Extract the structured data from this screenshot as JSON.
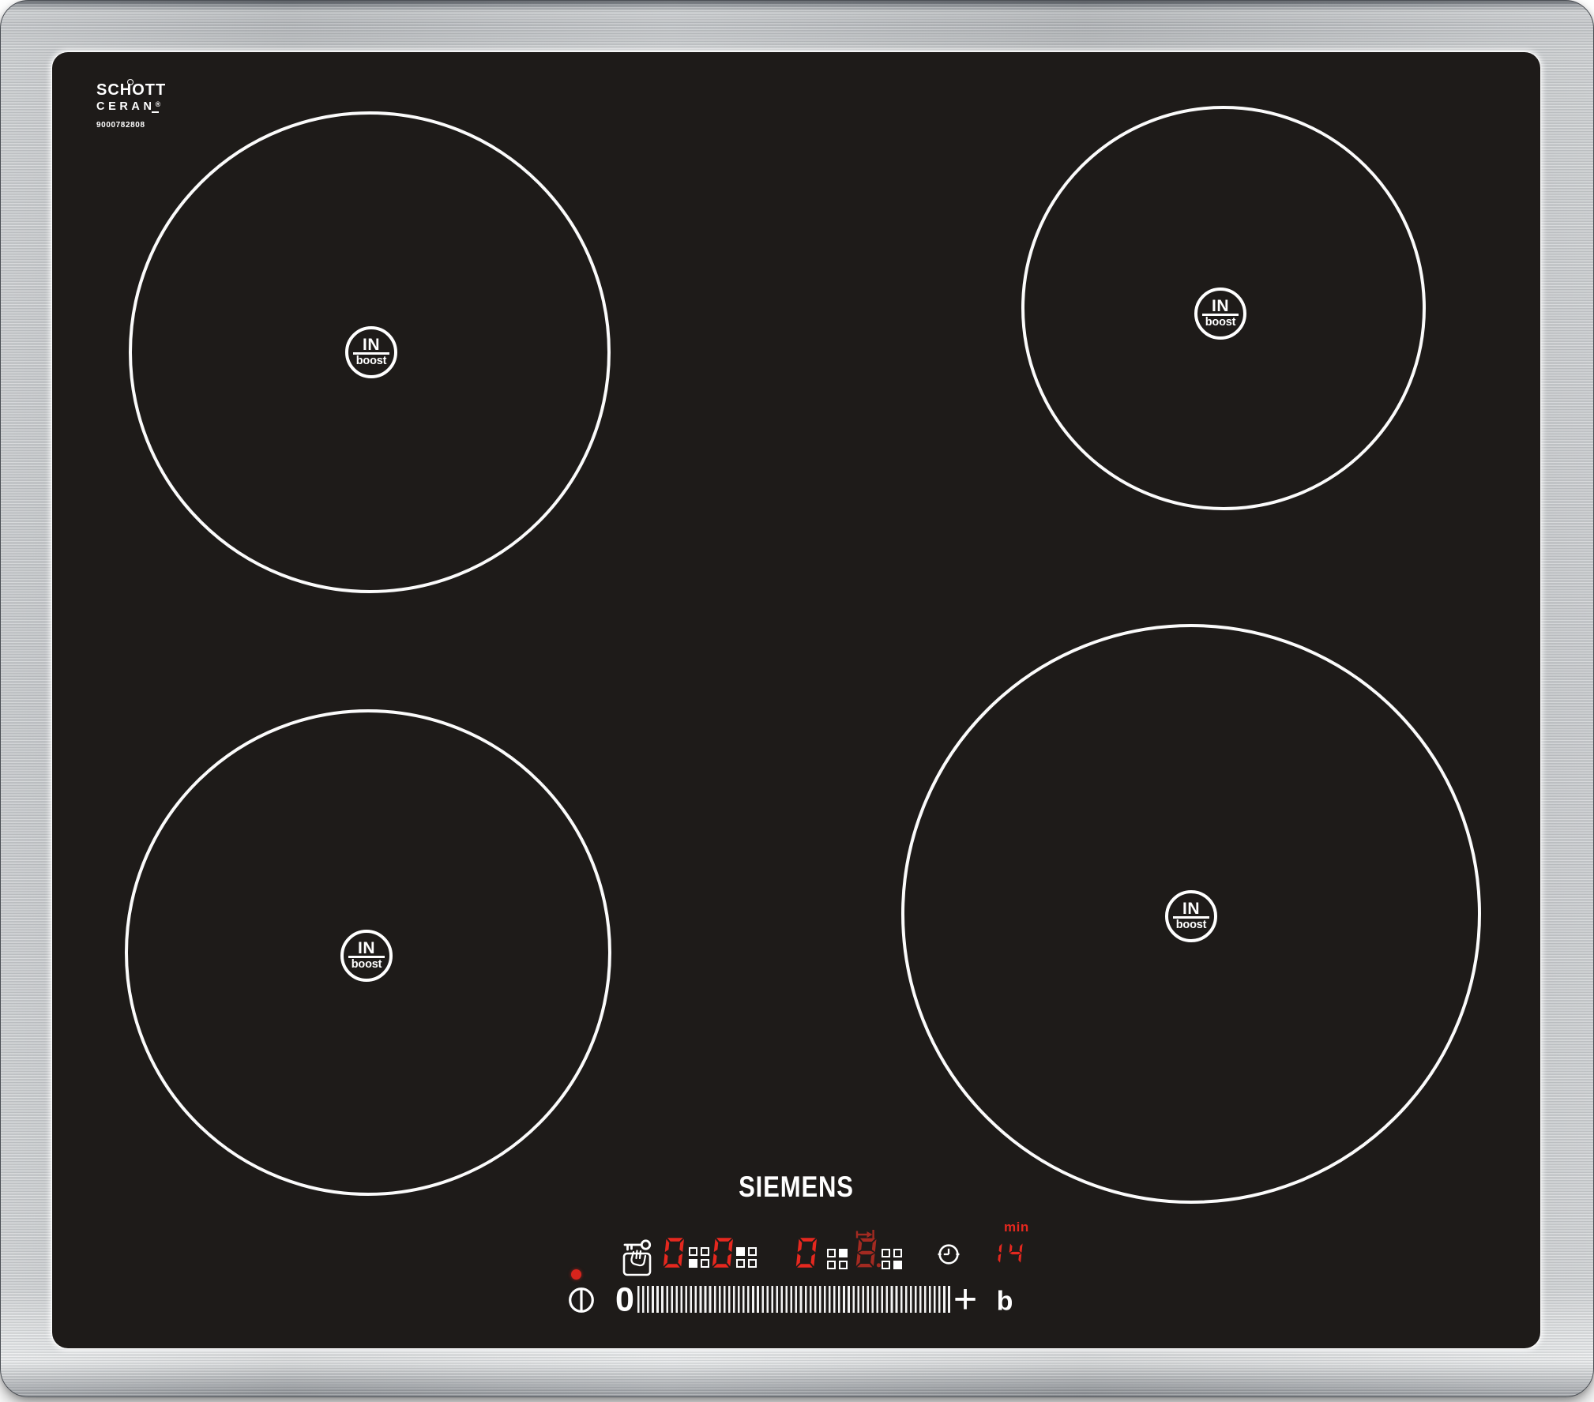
{
  "branding": {
    "glass_brand_line1": "SCHOTT",
    "glass_brand_line2": "CERAN",
    "registered_mark": "®",
    "model_number": "9000782808",
    "logo": "SIEMENS"
  },
  "zones": [
    {
      "name": "back-left",
      "badge_top": "IN",
      "badge_bottom": "boost"
    },
    {
      "name": "back-right",
      "badge_top": "IN",
      "badge_bottom": "boost"
    },
    {
      "name": "front-left",
      "badge_top": "IN",
      "badge_bottom": "boost"
    },
    {
      "name": "front-right",
      "badge_top": "IN",
      "badge_bottom": "boost"
    }
  ],
  "controls": {
    "power_led": "on",
    "icons": {
      "child_lock": "key-touch-lock-icon",
      "power": "power-icon",
      "timer": "clock-icon",
      "timer_marker": "arrow-to-bar-icon"
    },
    "zone_displays": [
      {
        "power_level": "0",
        "zone": "front-left",
        "filled": "bottom-left",
        "tone": "bright"
      },
      {
        "power_level": "0",
        "zone": "back-left",
        "filled": "top-left",
        "tone": "bright"
      },
      {
        "power_level": "0",
        "zone": "back-right",
        "filled": "top-right",
        "tone": "bright"
      },
      {
        "power_level": "8.",
        "zone": "front-right",
        "filled": "bottom-right",
        "tone": "dim"
      }
    ],
    "timer": {
      "unit_label": "min",
      "value": "14"
    },
    "slider": {
      "zero_label": "0",
      "plus_label": "+",
      "boost_label": "b"
    }
  },
  "colors": {
    "glass_black": "#1e1b19",
    "bright_red": "#e5281f",
    "dim_red": "#a32a21",
    "white": "#ffffff",
    "steel": "#c6c9cc"
  }
}
